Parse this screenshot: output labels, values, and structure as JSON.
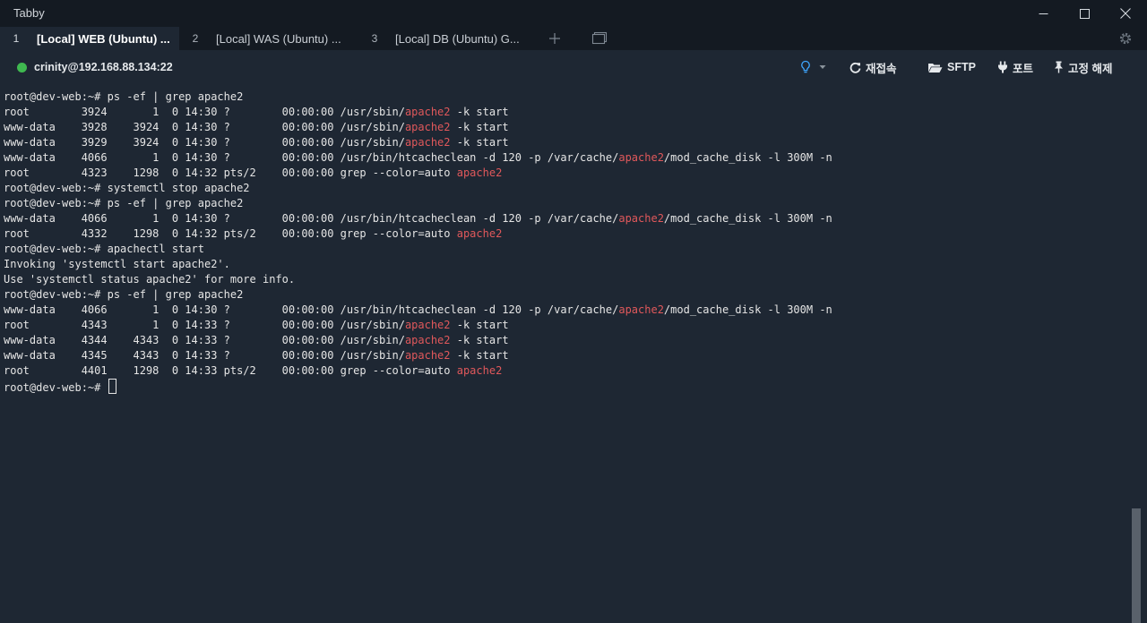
{
  "window": {
    "title": "Tabby"
  },
  "tabs": [
    {
      "num": "1",
      "label": "[Local] WEB (Ubuntu) ...",
      "active": true
    },
    {
      "num": "2",
      "label": "[Local] WAS (Ubuntu) ...",
      "active": false
    },
    {
      "num": "3",
      "label": "[Local] DB (Ubuntu) G...",
      "active": false
    }
  ],
  "toolbar": {
    "connection": "crinity@192.168.88.134:22",
    "reconnect": "재접속",
    "sftp": "SFTP",
    "ports": "포트",
    "pin": "고정 해제"
  },
  "colors": {
    "connected": "#3fb950",
    "highlight": "#e0585b",
    "hint": "#3ea6ff"
  },
  "terminal": {
    "lines": [
      [
        {
          "t": "root@dev-web:~# ps -ef | grep apache2"
        }
      ],
      [
        {
          "t": "root        3924       1  0 14:30 ?        00:00:00 /usr/sbin/"
        },
        {
          "t": "apache2",
          "hl": true
        },
        {
          "t": " -k start"
        }
      ],
      [
        {
          "t": "www-data    3928    3924  0 14:30 ?        00:00:00 /usr/sbin/"
        },
        {
          "t": "apache2",
          "hl": true
        },
        {
          "t": " -k start"
        }
      ],
      [
        {
          "t": "www-data    3929    3924  0 14:30 ?        00:00:00 /usr/sbin/"
        },
        {
          "t": "apache2",
          "hl": true
        },
        {
          "t": " -k start"
        }
      ],
      [
        {
          "t": "www-data    4066       1  0 14:30 ?        00:00:00 /usr/bin/htcacheclean -d 120 -p /var/cache/"
        },
        {
          "t": "apache2",
          "hl": true
        },
        {
          "t": "/mod_cache_disk -l 300M -n"
        }
      ],
      [
        {
          "t": "root        4323    1298  0 14:32 pts/2    00:00:00 grep --color=auto "
        },
        {
          "t": "apache2",
          "hl": true
        }
      ],
      [
        {
          "t": "root@dev-web:~# systemctl stop apache2"
        }
      ],
      [
        {
          "t": "root@dev-web:~# ps -ef | grep apache2"
        }
      ],
      [
        {
          "t": "www-data    4066       1  0 14:30 ?        00:00:00 /usr/bin/htcacheclean -d 120 -p /var/cache/"
        },
        {
          "t": "apache2",
          "hl": true
        },
        {
          "t": "/mod_cache_disk -l 300M -n"
        }
      ],
      [
        {
          "t": "root        4332    1298  0 14:32 pts/2    00:00:00 grep --color=auto "
        },
        {
          "t": "apache2",
          "hl": true
        }
      ],
      [
        {
          "t": "root@dev-web:~# apachectl start"
        }
      ],
      [
        {
          "t": "Invoking 'systemctl start apache2'."
        }
      ],
      [
        {
          "t": "Use 'systemctl status apache2' for more info."
        }
      ],
      [
        {
          "t": "root@dev-web:~# ps -ef | grep apache2"
        }
      ],
      [
        {
          "t": "www-data    4066       1  0 14:30 ?        00:00:00 /usr/bin/htcacheclean -d 120 -p /var/cache/"
        },
        {
          "t": "apache2",
          "hl": true
        },
        {
          "t": "/mod_cache_disk -l 300M -n"
        }
      ],
      [
        {
          "t": "root        4343       1  0 14:33 ?        00:00:00 /usr/sbin/"
        },
        {
          "t": "apache2",
          "hl": true
        },
        {
          "t": " -k start"
        }
      ],
      [
        {
          "t": "www-data    4344    4343  0 14:33 ?        00:00:00 /usr/sbin/"
        },
        {
          "t": "apache2",
          "hl": true
        },
        {
          "t": " -k start"
        }
      ],
      [
        {
          "t": "www-data    4345    4343  0 14:33 ?        00:00:00 /usr/sbin/"
        },
        {
          "t": "apache2",
          "hl": true
        },
        {
          "t": " -k start"
        }
      ],
      [
        {
          "t": "root        4401    1298  0 14:33 pts/2    00:00:00 grep --color=auto "
        },
        {
          "t": "apache2",
          "hl": true
        }
      ],
      [
        {
          "t": "root@dev-web:~# "
        }
      ]
    ]
  }
}
